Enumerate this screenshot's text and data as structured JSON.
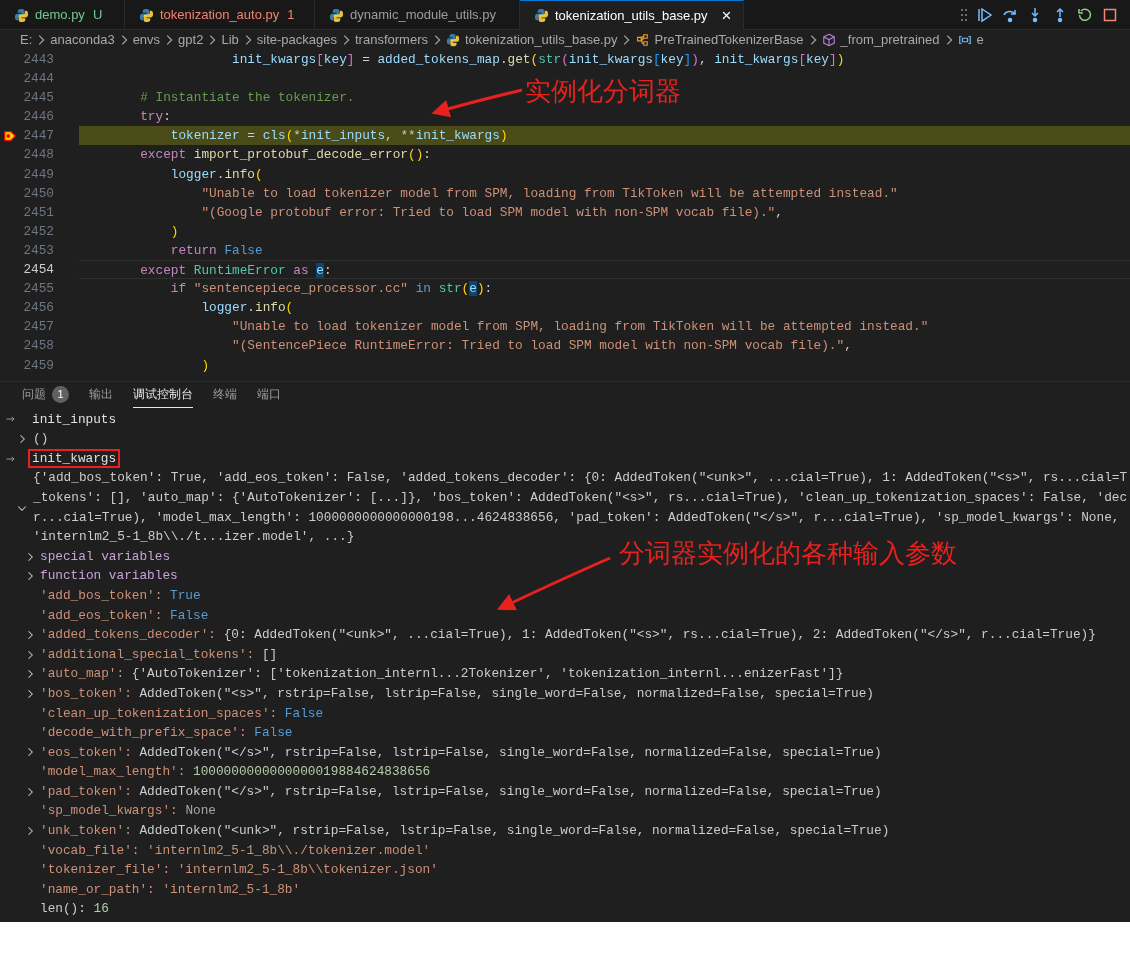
{
  "tabs": [
    {
      "label": "demo.py",
      "badge": "U",
      "kind": "untracked",
      "selected": false
    },
    {
      "label": "tokenization_auto.py",
      "badge": "1",
      "kind": "problem",
      "selected": false
    },
    {
      "label": "dynamic_module_utils.py",
      "kind": "plain",
      "selected": false
    },
    {
      "label": "tokenization_utils_base.py",
      "kind": "plain",
      "selected": true,
      "close": "×"
    }
  ],
  "breadcrumb": [
    {
      "text": "E:",
      "kind": "folder"
    },
    {
      "text": "anaconda3",
      "kind": "folder"
    },
    {
      "text": "envs",
      "kind": "folder"
    },
    {
      "text": "gpt2",
      "kind": "folder"
    },
    {
      "text": "Lib",
      "kind": "folder"
    },
    {
      "text": "site-packages",
      "kind": "folder"
    },
    {
      "text": "transformers",
      "kind": "folder"
    },
    {
      "text": "tokenization_utils_base.py",
      "kind": "file"
    },
    {
      "text": "PreTrainedTokenizerBase",
      "kind": "class"
    },
    {
      "text": "_from_pretrained",
      "kind": "method"
    },
    {
      "text": "e",
      "kind": "variable"
    }
  ],
  "editor": {
    "lines": [
      {
        "number": "2443",
        "paused": false,
        "cursor": false,
        "tokens": [
          {
            "text": "                    init_kwargs",
            "kind": "var"
          },
          {
            "text": "[",
            "kind": "b2"
          },
          {
            "text": "key",
            "kind": "var"
          },
          {
            "text": "]",
            "kind": "b2"
          },
          {
            "text": " = ",
            "kind": "plain"
          },
          {
            "text": "added_tokens_map",
            "kind": "var"
          },
          {
            "text": ".",
            "kind": "plain"
          },
          {
            "text": "get",
            "kind": "fn"
          },
          {
            "text": "(",
            "kind": "b1"
          },
          {
            "text": "str",
            "kind": "cls"
          },
          {
            "text": "(",
            "kind": "b2"
          },
          {
            "text": "init_kwargs",
            "kind": "var"
          },
          {
            "text": "[",
            "kind": "b3"
          },
          {
            "text": "key",
            "kind": "var"
          },
          {
            "text": "]",
            "kind": "b3"
          },
          {
            "text": ")",
            "kind": "b2"
          },
          {
            "text": ", ",
            "kind": "plain"
          },
          {
            "text": "init_kwargs",
            "kind": "var"
          },
          {
            "text": "[",
            "kind": "b2"
          },
          {
            "text": "key",
            "kind": "var"
          },
          {
            "text": "]",
            "kind": "b2"
          },
          {
            "text": ")",
            "kind": "b1"
          }
        ]
      },
      {
        "number": "2444",
        "paused": false,
        "cursor": false
      },
      {
        "number": "2445",
        "paused": false,
        "cursor": false,
        "tokens": [
          {
            "text": "        # Instantiate the tokenizer.",
            "kind": "cm"
          }
        ]
      },
      {
        "number": "2446",
        "paused": false,
        "cursor": false,
        "tokens": [
          {
            "text": "        try",
            "kind": "kw"
          },
          {
            "text": ":",
            "kind": "plain"
          }
        ]
      },
      {
        "number": "2447",
        "paused": true,
        "cursor": false,
        "tokens": [
          {
            "text": "            tokenizer",
            "kind": "var"
          },
          {
            "text": " = ",
            "kind": "plain"
          },
          {
            "text": "cls",
            "kind": "var"
          },
          {
            "text": "(",
            "kind": "b1"
          },
          {
            "text": "*",
            "kind": "plain"
          },
          {
            "text": "init_inputs",
            "kind": "var"
          },
          {
            "text": ", **",
            "kind": "plain"
          },
          {
            "text": "init_kwargs",
            "kind": "var"
          },
          {
            "text": ")",
            "kind": "b1"
          }
        ]
      },
      {
        "number": "2448",
        "paused": false,
        "cursor": false,
        "tokens": [
          {
            "text": "        except ",
            "kind": "kw"
          },
          {
            "text": "import_protobuf_decode_error",
            "kind": "fn"
          },
          {
            "text": "()",
            "kind": "b1"
          },
          {
            "text": ":",
            "kind": "plain"
          }
        ]
      },
      {
        "number": "2449",
        "paused": false,
        "cursor": false,
        "tokens": [
          {
            "text": "            logger",
            "kind": "var"
          },
          {
            "text": ".",
            "kind": "plain"
          },
          {
            "text": "info",
            "kind": "fn"
          },
          {
            "text": "(",
            "kind": "b1"
          }
        ]
      },
      {
        "number": "2450",
        "paused": false,
        "cursor": false,
        "tokens": [
          {
            "text": "                \"Unable to load tokenizer model from SPM, loading from TikToken will be attempted instead.\"",
            "kind": "str"
          }
        ]
      },
      {
        "number": "2451",
        "paused": false,
        "cursor": false,
        "tokens": [
          {
            "text": "                \"(Google protobuf error: Tried to load SPM model with non-SPM vocab file).\"",
            "kind": "str"
          },
          {
            "text": ",",
            "kind": "plain"
          }
        ]
      },
      {
        "number": "2452",
        "paused": false,
        "cursor": false,
        "tokens": [
          {
            "text": "            )",
            "kind": "b1"
          }
        ]
      },
      {
        "number": "2453",
        "paused": false,
        "cursor": false,
        "tokens": [
          {
            "text": "            return ",
            "kind": "kw"
          },
          {
            "text": "False",
            "kind": "const"
          }
        ]
      },
      {
        "number": "2454",
        "paused": false,
        "cursor": true,
        "tokens": [
          {
            "text": "        except ",
            "kind": "kw"
          },
          {
            "text": "RuntimeError ",
            "kind": "cls"
          },
          {
            "text": "as ",
            "kind": "kw"
          },
          {
            "text": "e",
            "kind": "var",
            "highlighted": true
          },
          {
            "text": ":",
            "kind": "plain"
          }
        ]
      },
      {
        "number": "2455",
        "paused": false,
        "cursor": false,
        "tokens": [
          {
            "text": "            if ",
            "kind": "kw"
          },
          {
            "text": "\"sentencepiece_processor.cc\" ",
            "kind": "str"
          },
          {
            "text": "in ",
            "kind": "const"
          },
          {
            "text": "str",
            "kind": "cls"
          },
          {
            "text": "(",
            "kind": "b1"
          },
          {
            "text": "e",
            "kind": "var",
            "highlighted": true
          },
          {
            "text": ")",
            "kind": "b1"
          },
          {
            "text": ":",
            "kind": "plain"
          }
        ]
      },
      {
        "number": "2456",
        "paused": false,
        "cursor": false,
        "tokens": [
          {
            "text": "                logger",
            "kind": "var"
          },
          {
            "text": ".",
            "kind": "plain"
          },
          {
            "text": "info",
            "kind": "fn"
          },
          {
            "text": "(",
            "kind": "b1"
          }
        ]
      },
      {
        "number": "2457",
        "paused": false,
        "cursor": false,
        "tokens": [
          {
            "text": "                    \"Unable to load tokenizer model from SPM, loading from TikToken will be attempted instead.\"",
            "kind": "str"
          }
        ]
      },
      {
        "number": "2458",
        "paused": false,
        "cursor": false,
        "tokens": [
          {
            "text": "                    \"(SentencePiece RuntimeError: Tried to load SPM model with non-SPM vocab file).\"",
            "kind": "str"
          },
          {
            "text": ",",
            "kind": "plain"
          }
        ]
      },
      {
        "number": "2459",
        "paused": false,
        "cursor": false,
        "tokens": [
          {
            "text": "                )",
            "kind": "b1"
          }
        ]
      }
    ]
  },
  "panel": {
    "tabs": [
      {
        "label": "问题",
        "badge": "1",
        "selected": false
      },
      {
        "label": "输出",
        "selected": false
      },
      {
        "label": "调试控制台",
        "selected": true
      },
      {
        "label": "终端",
        "selected": false
      },
      {
        "label": "端口",
        "selected": false
      }
    ]
  },
  "console": [
    {
      "kind": "expression",
      "text": "init_inputs",
      "boxed": false
    },
    {
      "kind": "result",
      "expanded": false,
      "lines": [
        "()"
      ]
    },
    {
      "kind": "expression",
      "text": "init_kwargs",
      "boxed": true
    },
    {
      "kind": "result",
      "expanded": true,
      "lines": [
        "{'add_bos_token': True, 'add_eos_token': False, 'added_tokens_decoder': {0: AddedToken(\"<unk>\", ...cial=True), 1: AddedToken(\"<s>\", rs...cial=T",
        "_tokens': [], 'auto_map': {'AutoTokenizer': [...]}, 'bos_token': AddedToken(\"<s>\", rs...cial=True), 'clean_up_tokenization_spaces': False, 'dec",
        "r...cial=True), 'model_max_length': 1000000000000000198...4624838656, 'pad_token': AddedToken(\"</s>\", r...cial=True), 'sp_model_kwargs': None,",
        "'internlm2_5-1_8b\\\\./t...izer.model', ...}"
      ],
      "children": [
        {
          "kind": "group",
          "name": "special variables",
          "expandable": true
        },
        {
          "kind": "group",
          "name": "function variables",
          "expandable": true
        },
        {
          "kind": "bool",
          "name": "'add_bos_token':",
          "value": "True",
          "expandable": false
        },
        {
          "kind": "bool",
          "name": "'add_eos_token':",
          "value": "False",
          "expandable": false
        },
        {
          "kind": "object",
          "name": "'added_tokens_decoder':",
          "value": "{0: AddedToken(\"<unk>\", ...cial=True), 1: AddedToken(\"<s>\", rs...cial=True), 2: AddedToken(\"</s>\", r...cial=True)}",
          "expandable": true
        },
        {
          "kind": "object",
          "name": "'additional_special_tokens':",
          "value": "[]",
          "expandable": true
        },
        {
          "kind": "object",
          "name": "'auto_map':",
          "value": "{'AutoTokenizer': ['tokenization_internl...2Tokenizer', 'tokenization_internl...enizerFast']}",
          "expandable": true
        },
        {
          "kind": "object",
          "name": "'bos_token':",
          "value": "AddedToken(\"<s>\", rstrip=False, lstrip=False, single_word=False, normalized=False, special=True)",
          "expandable": true
        },
        {
          "kind": "bool",
          "name": "'clean_up_tokenization_spaces':",
          "value": "False",
          "expandable": false
        },
        {
          "kind": "bool",
          "name": "'decode_with_prefix_space':",
          "value": "False",
          "expandable": false
        },
        {
          "kind": "object",
          "name": "'eos_token':",
          "value": "AddedToken(\"</s>\", rstrip=False, lstrip=False, single_word=False, normalized=False, special=True)",
          "expandable": true
        },
        {
          "kind": "number",
          "name": "'model_max_length':",
          "value": "1000000000000000019884624838656",
          "expandable": false
        },
        {
          "kind": "object",
          "name": "'pad_token':",
          "value": "AddedToken(\"</s>\", rstrip=False, lstrip=False, single_word=False, normalized=False, special=True)",
          "expandable": true
        },
        {
          "kind": "none",
          "name": "'sp_model_kwargs':",
          "value": "None",
          "expandable": false
        },
        {
          "kind": "object",
          "name": "'unk_token':",
          "value": "AddedToken(\"<unk>\", rstrip=False, lstrip=False, single_word=False, normalized=False, special=True)",
          "expandable": true
        },
        {
          "kind": "string",
          "name": "'vocab_file':",
          "value": "'internlm2_5-1_8b\\\\./tokenizer.model'",
          "expandable": false
        },
        {
          "kind": "string",
          "name": "'tokenizer_file':",
          "value": "'internlm2_5-1_8b\\\\tokenizer.json'",
          "expandable": false
        },
        {
          "kind": "string",
          "name": "'name_or_path':",
          "value": "'internlm2_5-1_8b'",
          "expandable": false
        },
        {
          "kind": "meta",
          "name": "len():",
          "value": "16",
          "expandable": false
        }
      ]
    }
  ],
  "annotations": [
    {
      "text": "实例化分词器"
    },
    {
      "text": "分词器实例化的各种输入参数"
    }
  ]
}
